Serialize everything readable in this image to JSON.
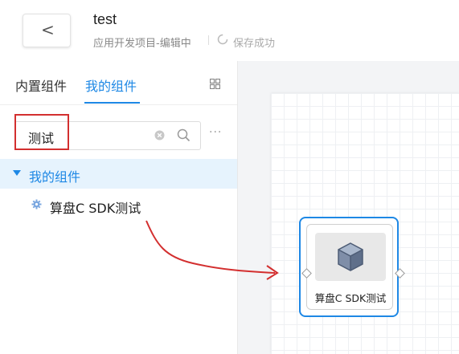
{
  "header": {
    "back_icon": "chevron-left-icon",
    "back_glyph": "<",
    "title": "test",
    "subtitle": "应用开发项目-编辑中",
    "save_status": "保存成功"
  },
  "sidebar": {
    "tabs": [
      {
        "label": "内置组件"
      },
      {
        "label": "我的组件"
      }
    ],
    "search": {
      "value": "测试"
    },
    "more_glyph": "···",
    "tree": {
      "group_label": "我的组件",
      "items": [
        {
          "label": "算盘C SDK测试"
        }
      ]
    }
  },
  "canvas": {
    "node": {
      "label": "算盘C SDK测试",
      "icon": "cube-icon"
    }
  },
  "colors": {
    "accent": "#1e88e5",
    "annotation": "#d32f2f"
  }
}
